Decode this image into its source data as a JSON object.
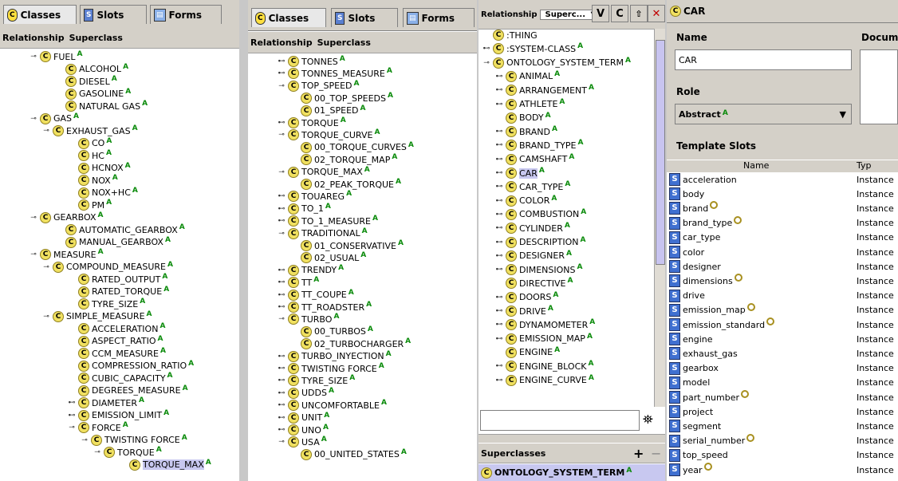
{
  "panel1": {
    "tabs": [
      "Classes",
      "Slots",
      "Forms"
    ],
    "rel_label": "Relationship",
    "rel_value": "Superclass",
    "rows": [
      {
        "label": "FUEL",
        "exp": "⚲"
      },
      {
        "label": "ALCOHOL",
        "exp": ""
      },
      {
        "label": "DIESEL",
        "exp": ""
      },
      {
        "label": "GASOLINE",
        "exp": ""
      },
      {
        "label": "NATURAL GAS",
        "exp": ""
      },
      {
        "label": "GAS",
        "exp": "⚲"
      },
      {
        "label": "EXHAUST_GAS",
        "exp": "⚲"
      },
      {
        "label": "CO",
        "exp": ""
      },
      {
        "label": "HC",
        "exp": ""
      },
      {
        "label": "HCNOX",
        "exp": ""
      },
      {
        "label": "NOX",
        "exp": ""
      },
      {
        "label": "NOX+HC",
        "exp": ""
      },
      {
        "label": "PM",
        "exp": ""
      },
      {
        "label": "GEARBOX",
        "exp": "⚲"
      },
      {
        "label": "AUTOMATIC_GEARBOX",
        "exp": ""
      },
      {
        "label": "MANUAL_GEARBOX",
        "exp": ""
      },
      {
        "label": "MEASURE",
        "exp": "⚲"
      },
      {
        "label": "COMPOUND_MEASURE",
        "exp": "⚲"
      },
      {
        "label": "RATED_OUTPUT",
        "exp": ""
      },
      {
        "label": "RATED_TORQUE",
        "exp": ""
      },
      {
        "label": "TYRE_SIZE",
        "exp": ""
      },
      {
        "label": "SIMPLE_MEASURE",
        "exp": "⚲"
      },
      {
        "label": "ACCELERATION",
        "exp": ""
      },
      {
        "label": "ASPECT_RATIO",
        "exp": ""
      },
      {
        "label": "CCM_MEASURE",
        "exp": ""
      },
      {
        "label": "COMPRESSION_RATIO",
        "exp": ""
      },
      {
        "label": "CUBIC_CAPACITY",
        "exp": ""
      },
      {
        "label": "DEGREES_MEASURE",
        "exp": ""
      },
      {
        "label": "DIAMETER",
        "exp": "⊶"
      },
      {
        "label": "EMISSION_LIMIT",
        "exp": "⊶"
      },
      {
        "label": "FORCE",
        "exp": "⚲"
      },
      {
        "label": "TWISTING FORCE",
        "exp": "⚲"
      },
      {
        "label": "TORQUE",
        "exp": "⚲"
      },
      {
        "label": "TORQUE_MAX",
        "exp": ""
      }
    ]
  },
  "panel2": {
    "tabs": [
      "Classes",
      "Slots",
      "Forms"
    ],
    "rel_label": "Relationship",
    "rel_value": "Superclass",
    "rows": [
      {
        "label": "TONNES",
        "exp": "⊶"
      },
      {
        "label": "TONNES_MEASURE",
        "exp": "⊶"
      },
      {
        "label": "TOP_SPEED",
        "exp": "⚲"
      },
      {
        "label": "00_TOP_SPEEDS",
        "exp": ""
      },
      {
        "label": "01_SPEED",
        "exp": ""
      },
      {
        "label": "TORQUE",
        "exp": "⊶"
      },
      {
        "label": "TORQUE_CURVE",
        "exp": "⚲"
      },
      {
        "label": "00_TORQUE_CURVES",
        "exp": ""
      },
      {
        "label": "02_TORQUE_MAP",
        "exp": ""
      },
      {
        "label": "TORQUE_MAX",
        "exp": "⚲"
      },
      {
        "label": "02_PEAK_TORQUE",
        "exp": ""
      },
      {
        "label": "TOUAREG",
        "exp": "⊶"
      },
      {
        "label": "TO_1",
        "exp": "⊶"
      },
      {
        "label": "TO_1_MEASURE",
        "exp": "⊶"
      },
      {
        "label": "TRADITIONAL",
        "exp": "⚲"
      },
      {
        "label": "01_CONSERVATIVE",
        "exp": ""
      },
      {
        "label": "02_USUAL",
        "exp": ""
      },
      {
        "label": "TRENDY",
        "exp": "⊶"
      },
      {
        "label": "TT",
        "exp": "⊶"
      },
      {
        "label": "TT_COUPE",
        "exp": "⊶"
      },
      {
        "label": "TT_ROADSTER",
        "exp": "⊶"
      },
      {
        "label": "TURBO",
        "exp": "⚲"
      },
      {
        "label": "00_TURBOS",
        "exp": ""
      },
      {
        "label": "02_TURBOCHARGER",
        "exp": ""
      },
      {
        "label": "TURBO_INYECTION",
        "exp": "⊶"
      },
      {
        "label": "TWISTING FORCE",
        "exp": "⊶"
      },
      {
        "label": "TYRE_SIZE",
        "exp": "⊶"
      },
      {
        "label": "UDDS",
        "exp": "⊶"
      },
      {
        "label": "UNCOMFORTABLE",
        "exp": "⊶"
      },
      {
        "label": "UNIT",
        "exp": "⊶"
      },
      {
        "label": "UNO",
        "exp": "⊶"
      },
      {
        "label": "USA",
        "exp": "⚲"
      },
      {
        "label": "00_UNITED_STATES",
        "exp": ""
      }
    ]
  },
  "panel3": {
    "rel_label": "Relationship",
    "rel_value": "Superc...",
    "btn_v": "V",
    "btn_c": "C",
    "btn_close": "✕",
    "rows": [
      {
        "label": ":THING",
        "exp": ""
      },
      {
        "label": ":SYSTEM-CLASS",
        "exp": "⊶"
      },
      {
        "label": "ONTOLOGY_SYSTEM_TERM",
        "exp": "⚲"
      },
      {
        "label": "ANIMAL",
        "exp": "⊶"
      },
      {
        "label": "ARRANGEMENT",
        "exp": "⊶"
      },
      {
        "label": "ATHLETE",
        "exp": "⊶"
      },
      {
        "label": "BODY",
        "exp": ""
      },
      {
        "label": "BRAND",
        "exp": "⊶"
      },
      {
        "label": "BRAND_TYPE",
        "exp": "⊶"
      },
      {
        "label": "CAMSHAFT",
        "exp": "⊶"
      },
      {
        "label": "CAR",
        "exp": "⊶"
      },
      {
        "label": "CAR_TYPE",
        "exp": "⊶"
      },
      {
        "label": "COLOR",
        "exp": "⊶"
      },
      {
        "label": "COMBUSTION",
        "exp": "⊶"
      },
      {
        "label": "CYLINDER",
        "exp": "⊶"
      },
      {
        "label": "DESCRIPTION",
        "exp": "⊶"
      },
      {
        "label": "DESIGNER",
        "exp": "⊶"
      },
      {
        "label": "DIMENSIONS",
        "exp": "⊶"
      },
      {
        "label": "DIRECTIVE",
        "exp": ""
      },
      {
        "label": "DOORS",
        "exp": "⊶"
      },
      {
        "label": "DRIVE",
        "exp": "⊶"
      },
      {
        "label": "DYNAMOMETER",
        "exp": "⊶"
      },
      {
        "label": "EMISSION_MAP",
        "exp": "⊶"
      },
      {
        "label": "ENGINE",
        "exp": ""
      },
      {
        "label": "ENGINE_BLOCK",
        "exp": "⊶"
      },
      {
        "label": "ENGINE_CURVE",
        "exp": "⊶"
      }
    ],
    "superclasses_label": "Superclasses",
    "superclass_item": "ONTOLOGY_SYSTEM_TERM",
    "add_btn": "+",
    "remove_btn": "−",
    "binoculars": "⛯"
  },
  "panel4": {
    "header_title": "CAR",
    "name_label": "Name",
    "doc_label": "Documer",
    "name_value": "CAR",
    "role_label": "Role",
    "role_value": "Abstract",
    "slots_label": "Template Slots",
    "col_name": "Name",
    "col_type": "Typ",
    "slots": [
      {
        "name": "acceleration",
        "type": "Instance",
        "dot": false
      },
      {
        "name": "body",
        "type": "Instance",
        "dot": false
      },
      {
        "name": "brand",
        "type": "Instance",
        "dot": true
      },
      {
        "name": "brand_type",
        "type": "Instance",
        "dot": true
      },
      {
        "name": "car_type",
        "type": "Instance",
        "dot": false
      },
      {
        "name": "color",
        "type": "Instance",
        "dot": false
      },
      {
        "name": "designer",
        "type": "Instance",
        "dot": false
      },
      {
        "name": "dimensions",
        "type": "Instance",
        "dot": true
      },
      {
        "name": "drive",
        "type": "Instance",
        "dot": false
      },
      {
        "name": "emission_map",
        "type": "Instance",
        "dot": true
      },
      {
        "name": "emission_standard",
        "type": "Instance",
        "dot": true
      },
      {
        "name": "engine",
        "type": "Instance",
        "dot": false
      },
      {
        "name": "exhaust_gas",
        "type": "Instance",
        "dot": false
      },
      {
        "name": "gearbox",
        "type": "Instance",
        "dot": false
      },
      {
        "name": "model",
        "type": "Instance",
        "dot": false
      },
      {
        "name": "part_number",
        "type": "Instance",
        "dot": true
      },
      {
        "name": "project",
        "type": "Instance",
        "dot": false
      },
      {
        "name": "segment",
        "type": "Instance",
        "dot": false
      },
      {
        "name": "serial_number",
        "type": "Instance",
        "dot": true
      },
      {
        "name": "top_speed",
        "type": "Instance",
        "dot": false
      },
      {
        "name": "year",
        "type": "Instance",
        "dot": true
      }
    ]
  },
  "icons": {
    "class": "C",
    "slot": "S",
    "annotation": "A"
  }
}
